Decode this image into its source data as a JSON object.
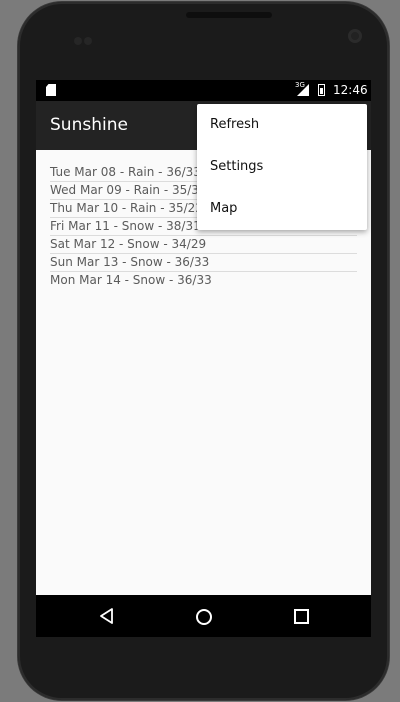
{
  "status_bar": {
    "network_type": "3G",
    "time": "12:46",
    "icons": [
      "sd-card-icon",
      "signal-icon",
      "battery-icon"
    ]
  },
  "app_bar": {
    "title": "Sunshine"
  },
  "forecast": {
    "items": [
      "Tue Mar 08 - Rain - 36/33",
      "Wed Mar 09 - Rain - 35/31",
      "Thu Mar 10 - Rain - 35/22",
      "Fri Mar 11 - Snow - 38/31",
      "Sat Mar 12 - Snow - 34/29",
      "Sun Mar 13 - Snow - 36/33",
      "Mon Mar 14 - Snow - 36/33"
    ]
  },
  "overflow_menu": {
    "items": [
      "Refresh",
      "Settings",
      "Map"
    ]
  },
  "nav_bar": {
    "icons": [
      "back-icon",
      "home-icon",
      "recents-icon"
    ]
  },
  "colors": {
    "background": "#7b7b7b",
    "app_bar": "#232323",
    "content": "#fafafa",
    "list_text": "#5b5b5b"
  }
}
